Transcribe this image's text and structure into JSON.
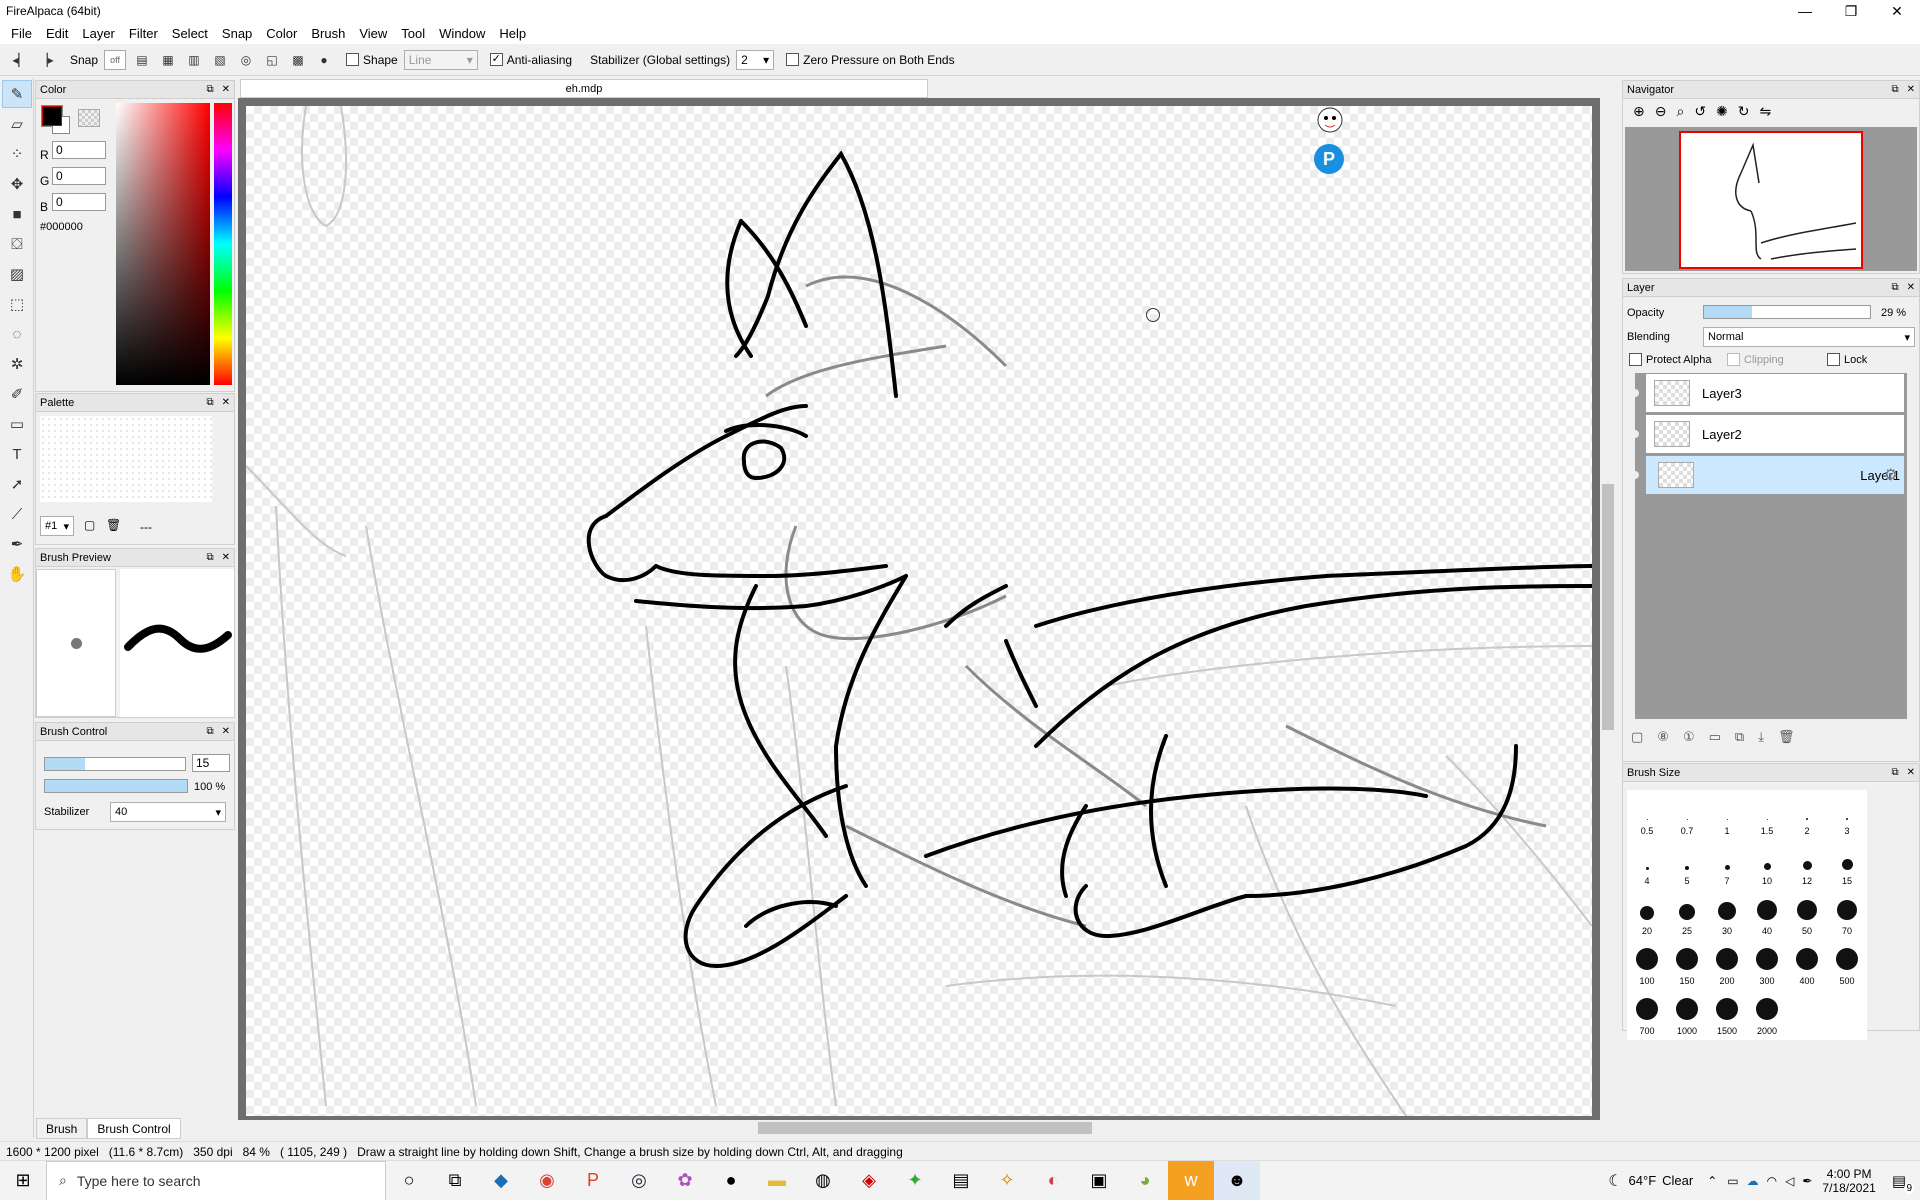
{
  "window": {
    "title": "FireAlpaca (64bit)",
    "minimize": "—",
    "maximize": "❐",
    "close": "✕"
  },
  "menu": [
    "File",
    "Edit",
    "Layer",
    "Filter",
    "Select",
    "Snap",
    "Color",
    "Brush",
    "View",
    "Tool",
    "Window",
    "Help"
  ],
  "toolbar": {
    "snap_label": "Snap",
    "snap_state": "off",
    "shape_label": "Shape",
    "shape_value": "Line",
    "antialias_label": "Anti-aliasing",
    "stabilizer_label": "Stabilizer (Global settings)",
    "stabilizer_value": "2",
    "zero_pressure_label": "Zero Pressure on Both Ends"
  },
  "document": {
    "tab": "eh.mdp"
  },
  "color_panel": {
    "title": "Color",
    "r_label": "R",
    "r": "0",
    "g_label": "G",
    "g": "0",
    "b_label": "B",
    "b": "0",
    "hex": "#000000",
    "primary_color": "#000000"
  },
  "palette_panel": {
    "title": "Palette",
    "set": "#1",
    "dash": "---"
  },
  "brush_preview": {
    "title": "Brush Preview"
  },
  "brush_control": {
    "title": "Brush Control",
    "size": "15",
    "opacity": "100 %",
    "stabilizer_label": "Stabilizer",
    "stabilizer": "40"
  },
  "navigator": {
    "title": "Navigator"
  },
  "layer_panel": {
    "title": "Layer",
    "opacity_label": "Opacity",
    "opacity": "29 %",
    "opacity_fraction": 0.29,
    "blending_label": "Blending",
    "blending": "Normal",
    "protect_alpha": "Protect Alpha",
    "clipping": "Clipping",
    "lock": "Lock",
    "layers": [
      {
        "name": "Layer3"
      },
      {
        "name": "Layer2"
      },
      {
        "name": "Layer1"
      }
    ]
  },
  "brush_size_panel": {
    "title": "Brush Size",
    "sizes": [
      "0.5",
      "0.7",
      "1",
      "1.5",
      "2",
      "3",
      "4",
      "5",
      "7",
      "10",
      "12",
      "15",
      "20",
      "25",
      "30",
      "40",
      "50",
      "70",
      "100",
      "150",
      "200",
      "300",
      "400",
      "500",
      "700",
      "1000",
      "1500",
      "2000"
    ]
  },
  "bottom_tabs": [
    "Brush",
    "Brush Control"
  ],
  "status": {
    "size": "1600 * 1200 pixel",
    "cm": "(11.6 * 8.7cm)",
    "dpi": "350 dpi",
    "zoom": "84 %",
    "pos": "( 1105, 249 )",
    "hint": "Draw a straight line by holding down Shift, Change a brush size by holding down Ctrl, Alt, and dragging"
  },
  "taskbar": {
    "search_placeholder": "Type here to search",
    "weather_temp": "64°F",
    "weather_text": "Clear",
    "time": "4:00 PM",
    "date": "7/18/2021",
    "notifications": "9"
  }
}
